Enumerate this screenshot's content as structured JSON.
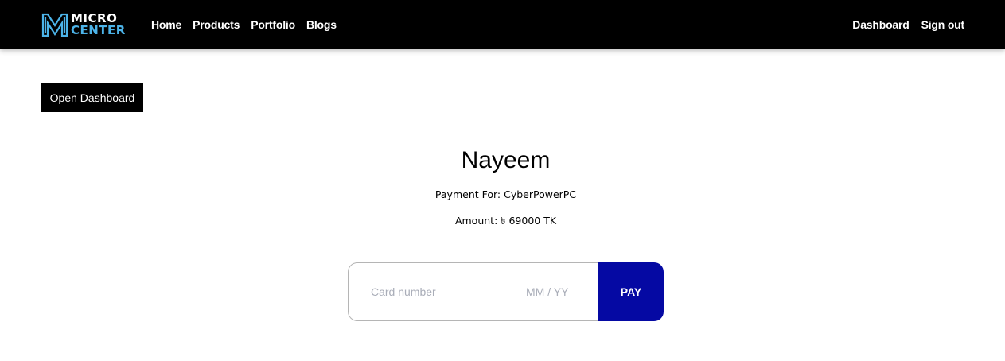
{
  "brand": {
    "line1": "MICRO",
    "line2": "CENTER",
    "logo_icon": "m-logo-icon",
    "accent_color": "#4cb3e8"
  },
  "nav": {
    "left": [
      "Home",
      "Products",
      "Portfolio",
      "Blogs"
    ],
    "right": [
      "Dashboard",
      "Sign out"
    ]
  },
  "open_dashboard_label": "Open Dashboard",
  "payment": {
    "payee": "Nayeem",
    "payment_for": "Payment For: CyberPowerPC",
    "amount": "Amount: ৳ 69000 TK",
    "card_number_placeholder": "Card number",
    "expiry_placeholder": "MM / YY",
    "pay_label": "PAY",
    "pay_color": "#0509a3"
  }
}
